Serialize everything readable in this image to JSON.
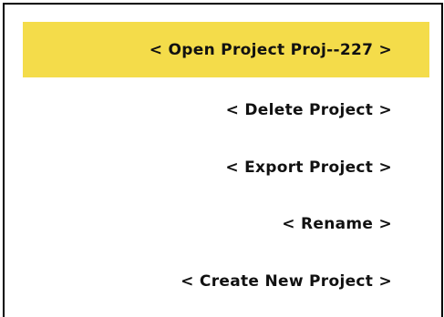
{
  "menu": {
    "selected_index": 0,
    "highlight_color": "#f4dc4a",
    "items": [
      {
        "label": "< Open Project Proj--227 >"
      },
      {
        "label": "< Delete Project >"
      },
      {
        "label": "< Export Project >"
      },
      {
        "label": "< Rename >"
      },
      {
        "label": "< Create New Project >"
      }
    ]
  }
}
